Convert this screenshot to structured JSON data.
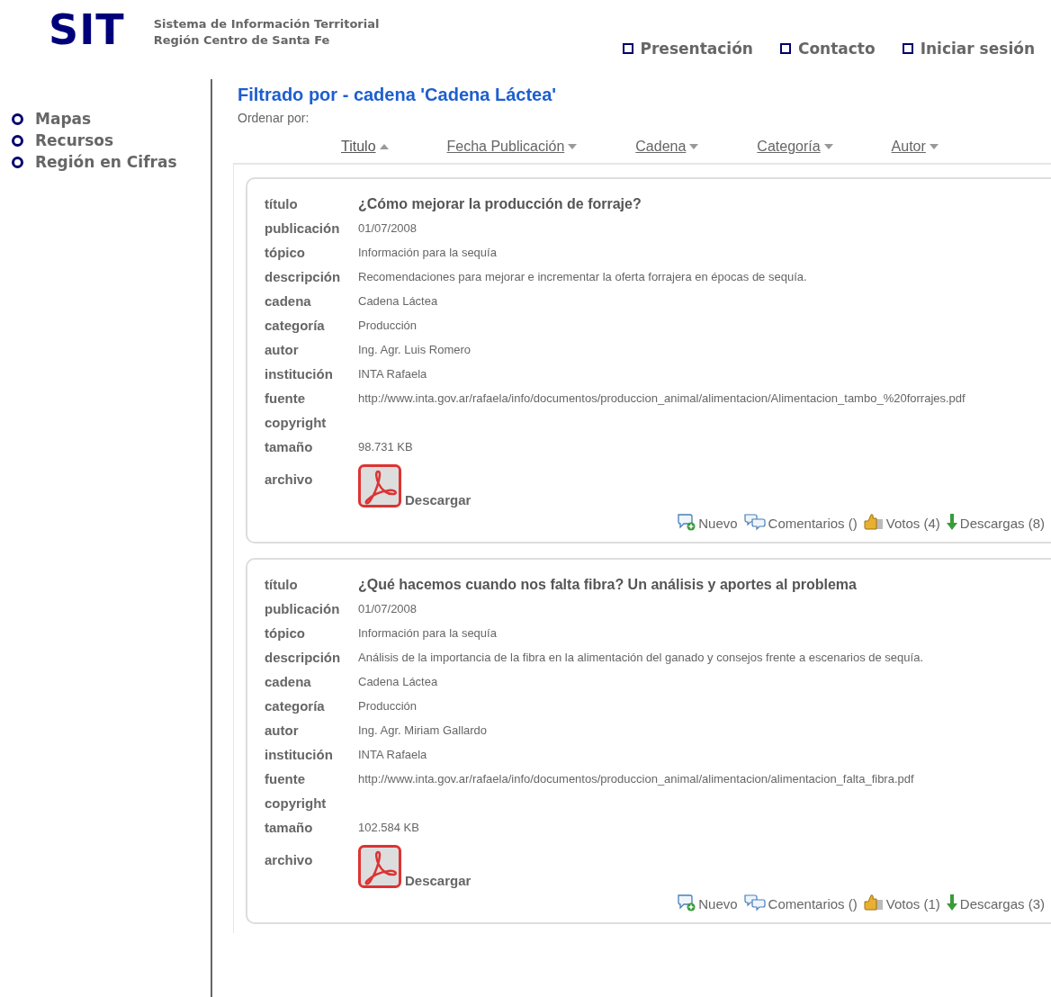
{
  "logo": "SIT",
  "subtitle": [
    "Sistema de Información Territorial",
    "Región Centro de Santa Fe"
  ],
  "top_nav": [
    "Presentación",
    "Contacto",
    "Iniciar sesión"
  ],
  "sidebar": {
    "items": [
      "Mapas",
      "Recursos",
      "Región en Cifras"
    ]
  },
  "heading": "Filtrado por - cadena 'Cadena Láctea'",
  "sort_label": "Ordenar por:",
  "sort_columns": [
    {
      "label": "Titulo",
      "selected": true
    },
    {
      "label": "Fecha Publicación",
      "selected": false
    },
    {
      "label": "Cadena",
      "selected": false
    },
    {
      "label": "Categoría",
      "selected": false
    },
    {
      "label": "Autor",
      "selected": false
    }
  ],
  "documents": [
    {
      "fields": [
        {
          "label": "título",
          "value": "¿Cómo mejorar la producción de forraje?",
          "kind": "title"
        },
        {
          "label": "publicación",
          "value": "01/07/2008",
          "kind": "text"
        },
        {
          "label": "tópico",
          "value": "Información para la sequía",
          "kind": "text"
        },
        {
          "label": "descripción",
          "value": "Recomendaciones para mejorar e incrementar la oferta forrajera en épocas de sequía.",
          "kind": "text"
        },
        {
          "label": "cadena",
          "value": "Cadena Láctea",
          "kind": "text"
        },
        {
          "label": "categoría",
          "value": "Producción",
          "kind": "text"
        },
        {
          "label": "autor",
          "value": "Ing. Agr. Luis Romero",
          "kind": "text"
        },
        {
          "label": "institución",
          "value": "INTA Rafaela",
          "kind": "text"
        },
        {
          "label": "fuente",
          "value": "http://www.inta.gov.ar/rafaela/info/documentos/produccion_animal/alimentacion/Alimentacion_tambo_%20forrajes.pdf",
          "kind": "text"
        },
        {
          "label": "copyright",
          "kind": "text"
        },
        {
          "label": "tamaño",
          "value": "98.731 KB",
          "kind": "text"
        },
        {
          "label": "archivo",
          "value": "Descargar",
          "kind": "file"
        }
      ],
      "actions": [
        "Nuevo",
        "Comentarios ()",
        "Votos (4)",
        "Descargas (8)"
      ]
    },
    {
      "fields": [
        {
          "label": "título",
          "value": "¿Qué hacemos cuando nos falta fibra? Un análisis y aportes al problema",
          "kind": "title"
        },
        {
          "label": "publicación",
          "value": "01/07/2008",
          "kind": "text"
        },
        {
          "label": "tópico",
          "value": "Información para la sequía",
          "kind": "text"
        },
        {
          "label": "descripción",
          "value": "Análisis de la importancia de la fibra en la alimentación del ganado y consejos frente a escenarios de sequía.",
          "kind": "text"
        },
        {
          "label": "cadena",
          "value": "Cadena Láctea",
          "kind": "text"
        },
        {
          "label": "categoría",
          "value": "Producción",
          "kind": "text"
        },
        {
          "label": "autor",
          "value": "Ing. Agr. Miriam Gallardo",
          "kind": "text"
        },
        {
          "label": "institución",
          "value": "INTA Rafaela",
          "kind": "text"
        },
        {
          "label": "fuente",
          "value": "http://www.inta.gov.ar/rafaela/info/documentos/produccion_animal/alimentacion/alimentacion_falta_fibra.pdf",
          "kind": "text"
        },
        {
          "label": "copyright",
          "kind": "text"
        },
        {
          "label": "tamaño",
          "value": "102.584 KB",
          "kind": "text"
        },
        {
          "label": "archivo",
          "value": "Descargar",
          "kind": "file"
        }
      ],
      "actions": [
        "Nuevo",
        "Comentarios ()",
        "Votos (1)",
        "Descargas (3)"
      ]
    }
  ]
}
